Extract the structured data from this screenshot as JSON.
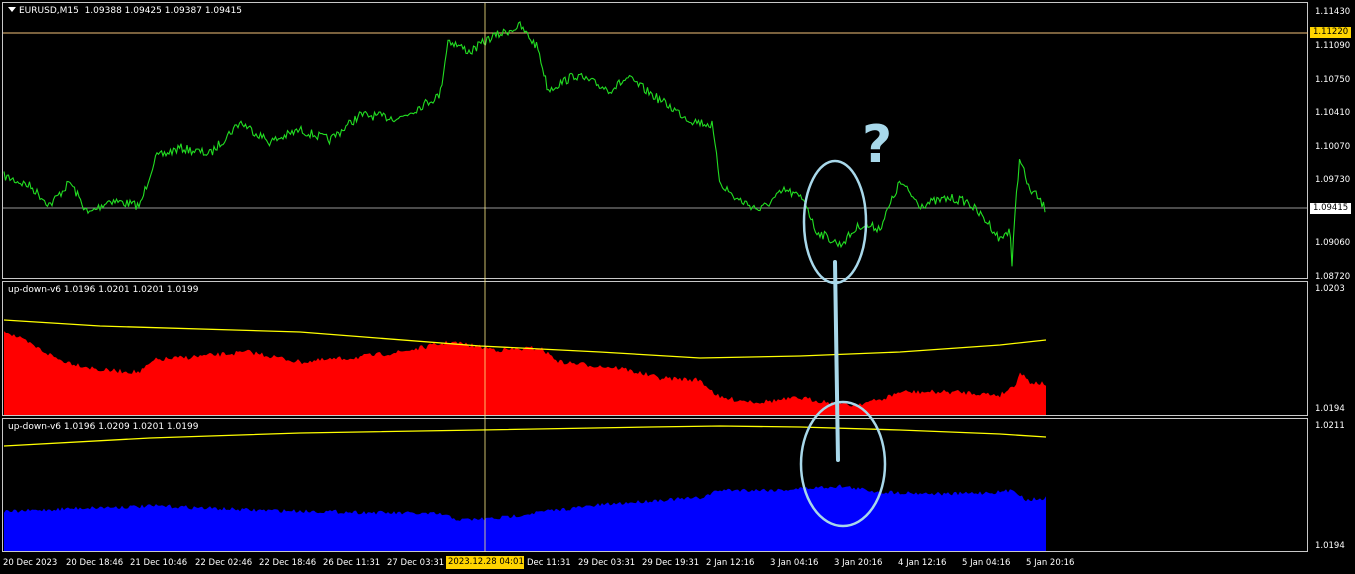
{
  "main_chart": {
    "symbol": "EURUSD,M15",
    "ohlc": "1.09388 1.09425 1.09387 1.09415",
    "price_axis": [
      "1.11430",
      "1.11090",
      "1.10750",
      "1.10410",
      "1.10070",
      "1.09730",
      "1.09060",
      "1.08720"
    ],
    "hline_price": "1.11220",
    "current_price": "1.09415",
    "line_color": "#22dd22",
    "hline_color": "#f5c27a"
  },
  "indicator1": {
    "label": "up-down-v6 1.0196 1.0201 1.0201 1.0199",
    "axis": [
      "1.0203",
      "1.0194"
    ],
    "fill_color": "#ff0000",
    "line_color": "#ffff00"
  },
  "indicator2": {
    "label": "up-down-v6 1.0196 1.0209 1.0201 1.0199",
    "axis": [
      "1.0211",
      "1.0194"
    ],
    "fill_color": "#0000ff",
    "line_color": "#ffff00"
  },
  "time_axis": [
    "20 Dec 2023",
    "20 Dec 18:46",
    "21 Dec 10:46",
    "22 Dec 02:46",
    "22 Dec 18:46",
    "26 Dec 11:31",
    "27 Dec 03:31",
    "Dec 11:31",
    "29 Dec 03:31",
    "29 Dec 19:31",
    "2 Jan 12:16",
    "3 Jan 04:16",
    "3 Jan 20:16",
    "4 Jan 12:16",
    "5 Jan 04:16",
    "5 Jan 20:16"
  ],
  "crosshair_time": "2023.12.28 04:01",
  "annotations": {
    "question_mark": "?",
    "annotation_color": "#a8d8ea"
  }
}
